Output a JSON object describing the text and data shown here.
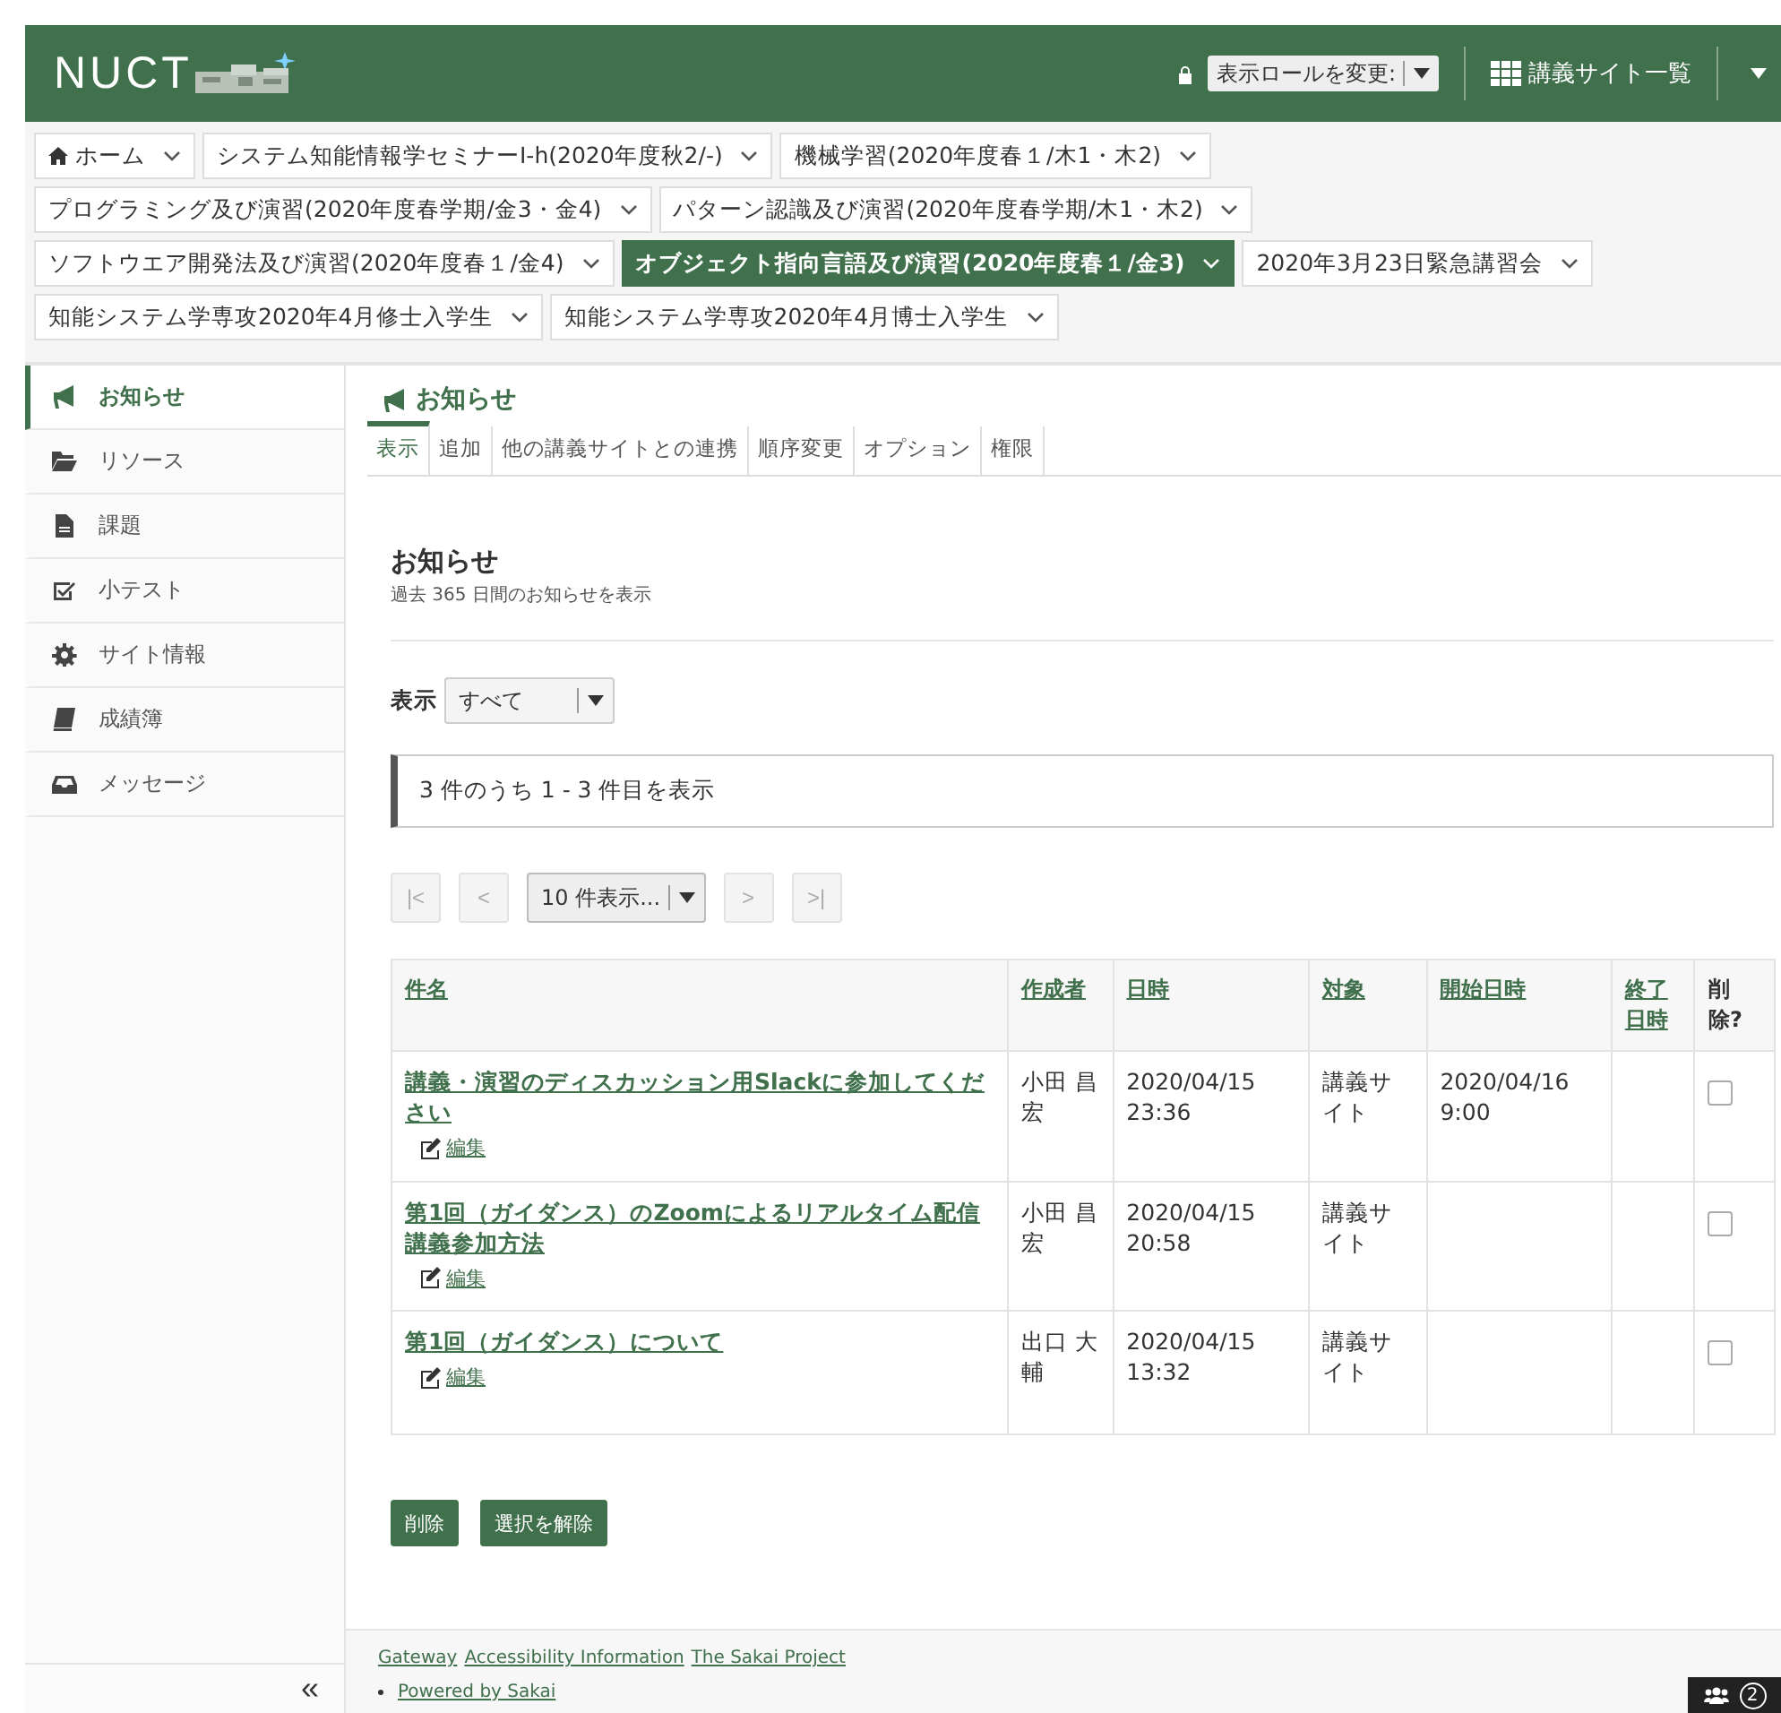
{
  "header": {
    "logo": "NUCT",
    "role_label": "表示ロールを変更:",
    "sites_link": "講義サイト一覧"
  },
  "site_tabs": [
    {
      "label": "ホーム",
      "kind": "home",
      "selected": false
    },
    {
      "label": "システム知能情報学セミナーⅠ-h(2020年度秋2/-)",
      "kind": "site",
      "selected": false
    },
    {
      "label": "機械学習(2020年度春１/木1・木2)",
      "kind": "site",
      "selected": false
    },
    {
      "label": "プログラミング及び演習(2020年度春学期/金3・金4)",
      "kind": "site",
      "selected": false
    },
    {
      "label": "パターン認識及び演習(2020年度春学期/木1・木2)",
      "kind": "site",
      "selected": false
    },
    {
      "label": "ソフトウエア開発法及び演習(2020年度春１/金4)",
      "kind": "site",
      "selected": false
    },
    {
      "label": "オブジェクト指向言語及び演習(2020年度春１/金3)",
      "kind": "site",
      "selected": true
    },
    {
      "label": "2020年3月23日緊急講習会",
      "kind": "site",
      "selected": false
    },
    {
      "label": "知能システム学専攻2020年4月修士入学生",
      "kind": "site",
      "selected": false
    },
    {
      "label": "知能システム学専攻2020年4月博士入学生",
      "kind": "site",
      "selected": false
    }
  ],
  "sidebar": {
    "items": [
      {
        "label": "お知らせ",
        "selected": true
      },
      {
        "label": "リソース",
        "selected": false
      },
      {
        "label": "課題",
        "selected": false
      },
      {
        "label": "小テスト",
        "selected": false
      },
      {
        "label": "サイト情報",
        "selected": false
      },
      {
        "label": "成績簿",
        "selected": false
      },
      {
        "label": "メッセージ",
        "selected": false
      }
    ],
    "collapse": "«"
  },
  "tool_title": "お知らせ",
  "tool_tabs": [
    {
      "label": "表示",
      "selected": true
    },
    {
      "label": "追加",
      "selected": false
    },
    {
      "label": "他の講義サイトとの連携",
      "selected": false
    },
    {
      "label": "順序変更",
      "selected": false
    },
    {
      "label": "オプション",
      "selected": false
    },
    {
      "label": "権限",
      "selected": false
    }
  ],
  "heading": "お知らせ",
  "subheading": "過去 365 日間のお知らせを表示",
  "view_filter": {
    "label": "表示",
    "value": "すべて"
  },
  "count_text": "3 件のうち 1 - 3 件目を表示",
  "pager": {
    "buttons": [
      {
        "label": "|<",
        "disabled": true
      },
      {
        "label": "<",
        "disabled": true
      },
      {
        "label": ">",
        "disabled": true
      },
      {
        "label": ">|",
        "disabled": true
      }
    ],
    "page_size": "10 件表示..."
  },
  "table": {
    "columns": [
      {
        "label": "件名",
        "sortable": true
      },
      {
        "label": "作成者",
        "sortable": true
      },
      {
        "label": "日時",
        "sortable": true
      },
      {
        "label": "対象",
        "sortable": true
      },
      {
        "label": "開始日時",
        "sortable": true
      },
      {
        "label": "終了日時",
        "sortable": true
      },
      {
        "label": "削除?",
        "sortable": false
      }
    ],
    "rows": [
      {
        "title": "講義・演習のディスカッション用Slackに参加してください",
        "edit": "編集",
        "author": "小田 昌宏",
        "date": "2020/04/15 23:36",
        "target": "講義サイト",
        "start": "2020/04/16 9:00",
        "delete": false
      },
      {
        "title": "第1回（ガイダンス）のZoomによるリアルタイム配信講義参加方法",
        "edit": "編集",
        "author": "小田 昌宏",
        "date": "2020/04/15 20:58",
        "target": "講義サイト",
        "delete": false
      },
      {
        "title": "第1回（ガイダンス）について",
        "edit": "編集",
        "author": "出口 大輔",
        "date": "2020/04/15 13:32",
        "target": "講義サイト",
        "delete": false
      }
    ]
  },
  "actions": [
    "削除",
    "選択を解除"
  ],
  "footer": {
    "links": [
      "Gateway",
      "Accessibility Information",
      "The Sakai Project"
    ],
    "powered": "Powered by Sakai",
    "presence_count": "2"
  }
}
